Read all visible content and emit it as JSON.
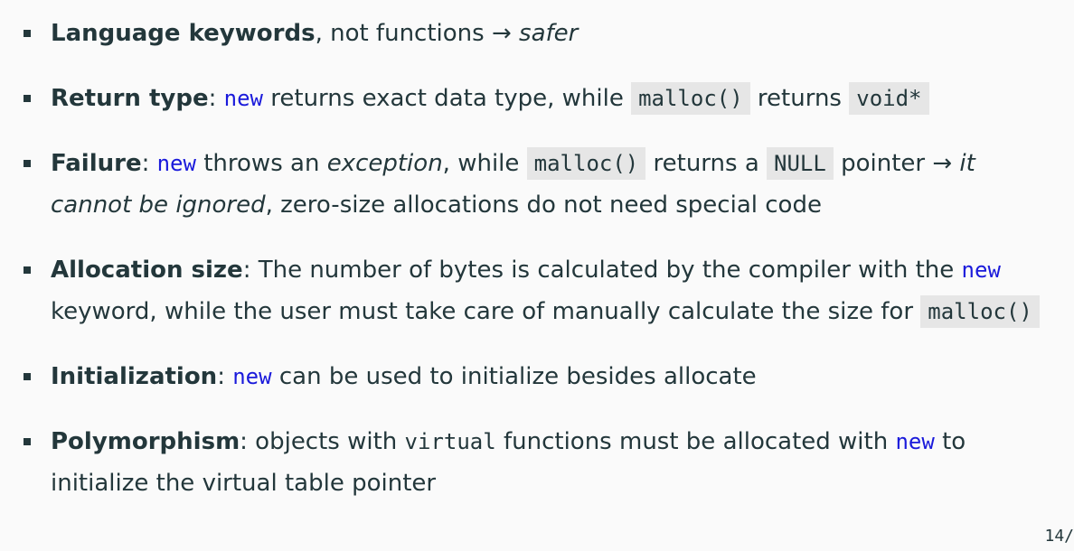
{
  "bullets": [
    {
      "term": "Language keywords",
      "t1": ", not functions ",
      "arrow": "→",
      "em": "safer"
    },
    {
      "term": "Return type",
      "t1": ": ",
      "kw": "new",
      "t2": " returns exact data type, while ",
      "code1": "malloc()",
      "t3": " returns ",
      "code2": "void*"
    },
    {
      "term": "Failure",
      "t1": ": ",
      "kw": "new",
      "t2": " throws an ",
      "em1": "exception",
      "t3": ", while ",
      "code1": "malloc()",
      "t4": " returns a ",
      "code2": "NULL",
      "t5": " pointer ",
      "arrow": "→",
      "em2": "it cannot be ignored",
      "t6": ", zero-size allocations do not need special code"
    },
    {
      "term": "Allocation size",
      "t1": ": The number of bytes is calculated by the compiler with the ",
      "kw": "new",
      "t2": " keyword, while the user must take care of manually calculate the size for ",
      "code1": "malloc()"
    },
    {
      "term": "Initialization",
      "t1": ": ",
      "kw": "new",
      "t2": " can be used to initialize besides allocate"
    },
    {
      "term": "Polymorphism",
      "t1": ": objects with ",
      "mono": "virtual",
      "t2": " functions must be allocated with ",
      "kw": "new",
      "t3": " to initialize the virtual table pointer"
    }
  ],
  "page_number": "14/"
}
